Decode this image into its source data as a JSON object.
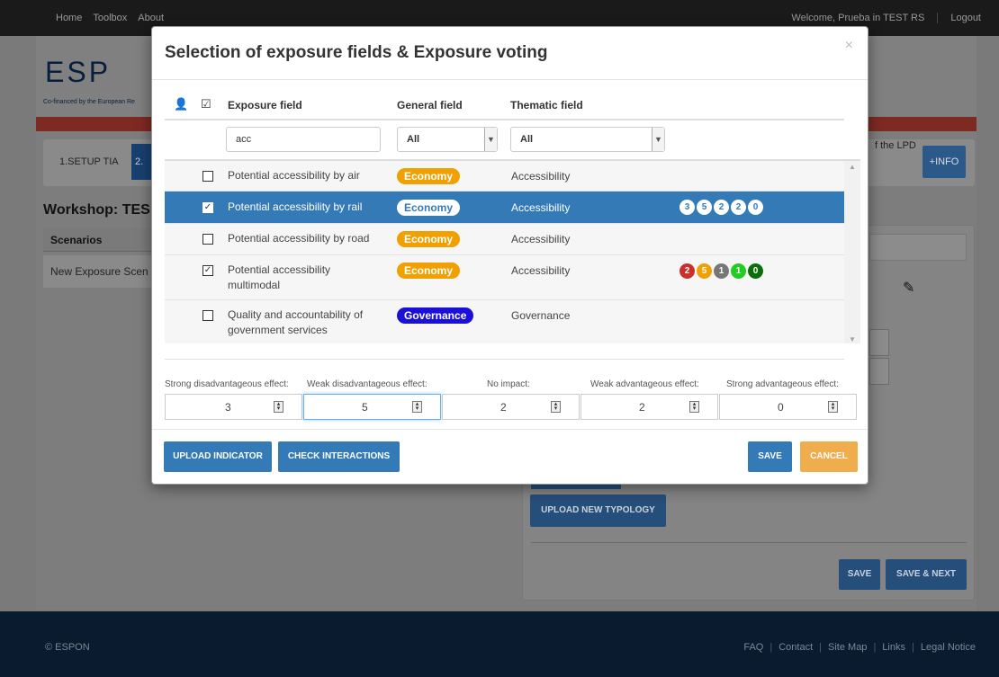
{
  "topbar": {
    "nav": [
      "Home",
      "Toolbox",
      "About"
    ],
    "welcome": "Welcome, Prueba in TEST RS",
    "logout": "Logout"
  },
  "logo": {
    "text": "ESP",
    "tagline": "Co-financed by the European Re"
  },
  "steps": {
    "step1": "1.SETUP TIA",
    "step2": "2.",
    "lpd": "f the LPD",
    "info": "+INFO"
  },
  "workshop": {
    "title": "Workshop: TES",
    "scenarios_header": "Scenarios",
    "scenario_row": "New Exposure Scen"
  },
  "right_panel": {
    "upload_typology": "UPLOAD NEW TYPOLOGY",
    "save": "SAVE",
    "save_next": "SAVE & NEXT"
  },
  "footer": {
    "copyright": "© ESPON",
    "links": [
      "FAQ",
      "Contact",
      "Site Map",
      "Links",
      "Legal Notice"
    ]
  },
  "modal": {
    "title": "Selection of exposure fields & Exposure voting",
    "close": "×",
    "columns": {
      "exposure": "Exposure field",
      "general": "General field",
      "thematic": "Thematic field"
    },
    "filters": {
      "exposure_value": "acc",
      "general_value": "All",
      "thematic_value": "All"
    },
    "rows": [
      {
        "name": "Potential accessibility by air",
        "checked": false,
        "general": "Economy",
        "thematic": "Accessibility",
        "votes": []
      },
      {
        "name": "Potential accessibility by rail",
        "checked": true,
        "general": "Economy",
        "thematic": "Accessibility",
        "votes": [
          "3",
          "5",
          "2",
          "2",
          "0"
        ]
      },
      {
        "name": "Potential accessibility by road",
        "checked": false,
        "general": "Economy",
        "thematic": "Accessibility",
        "votes": []
      },
      {
        "name": "Potential accessibility multimodal",
        "checked": true,
        "general": "Economy",
        "thematic": "Accessibility",
        "votes": [
          "2",
          "5",
          "1",
          "1",
          "0"
        ]
      },
      {
        "name": "Quality and accountability of government services",
        "checked": false,
        "general": "Governance",
        "thematic": "Governance",
        "votes": []
      }
    ],
    "vote_colors": [
      "#c9302c",
      "#f0a000",
      "#777777",
      "#22cc22",
      "#0b6e0b"
    ],
    "voting": [
      {
        "label": "Strong disadvantageous effect:",
        "value": "3"
      },
      {
        "label": "Weak disadvantageous effect:",
        "value": "5"
      },
      {
        "label": "No impact:",
        "value": "2"
      },
      {
        "label": "Weak advantageous effect:",
        "value": "2"
      },
      {
        "label": "Strong advantageous effect:",
        "value": "0"
      }
    ],
    "buttons": {
      "upload": "UPLOAD INDICATOR",
      "check": "CHECK INTERACTIONS",
      "save": "SAVE",
      "cancel": "CANCEL"
    }
  },
  "colors": {
    "primary": "#337ab7",
    "economy": "#f0a000",
    "governance": "#1a10d8",
    "cancel": "#f0ad4e"
  }
}
